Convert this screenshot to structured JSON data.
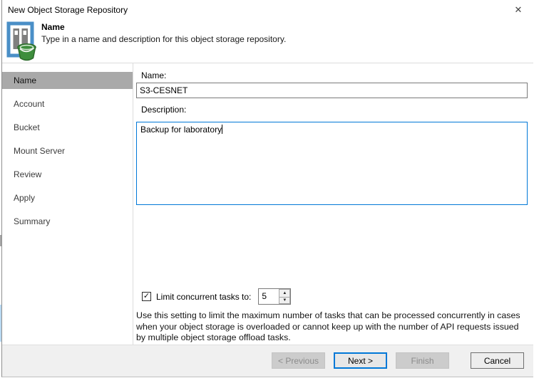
{
  "window": {
    "title": "New Object Storage Repository"
  },
  "icons": {
    "close": "✕",
    "check": "✓",
    "spin_up": "▲",
    "spin_down": "▼"
  },
  "header": {
    "step_title": "Name",
    "step_description": "Type in a name and description for this object storage repository."
  },
  "sidebar": {
    "items": [
      {
        "label": "Name",
        "selected": true
      },
      {
        "label": "Account",
        "selected": false
      },
      {
        "label": "Bucket",
        "selected": false
      },
      {
        "label": "Mount Server",
        "selected": false
      },
      {
        "label": "Review",
        "selected": false
      },
      {
        "label": "Apply",
        "selected": false
      },
      {
        "label": "Summary",
        "selected": false
      }
    ]
  },
  "form": {
    "name_label": "Name:",
    "name_value": "S3-CESNET",
    "description_label": "Description:",
    "description_value": "Backup for laboratory",
    "limit_label": "Limit concurrent tasks to:",
    "limit_checked": true,
    "limit_value": "5",
    "help_text": "Use this setting to limit the maximum number of tasks that can be processed concurrently in cases when your object storage is overloaded or cannot keep up with the number of API requests issued by multiple object storage offload tasks."
  },
  "footer": {
    "previous_label": "< Previous",
    "next_label": "Next >",
    "finish_label": "Finish",
    "cancel_label": "Cancel"
  },
  "colors": {
    "accent_blue": "#0078d7",
    "selected_step_bg": "#a9a9a9",
    "icon_frame_blue": "#4a8fc7",
    "bucket_green": "#3e8e3d",
    "footer_bg": "#f0f0f0"
  }
}
